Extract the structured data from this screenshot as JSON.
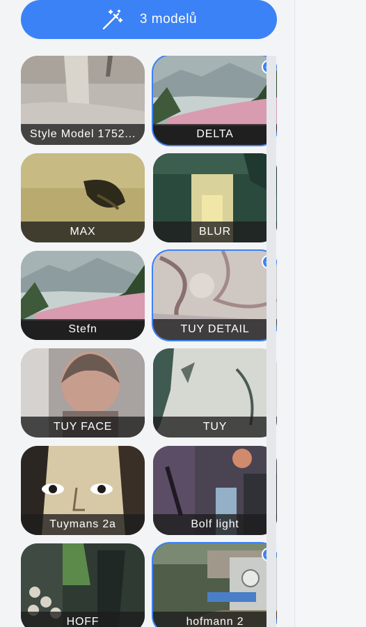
{
  "apply_button": {
    "label": "3 modelů",
    "icon": "magic-wand-icon"
  },
  "accent_color": "#3b82f6",
  "models": [
    {
      "name": "Style Model 1752...",
      "selected": false
    },
    {
      "name": "DELTA",
      "selected": true
    },
    {
      "name": "MAX",
      "selected": false
    },
    {
      "name": "BLUR",
      "selected": false
    },
    {
      "name": "Stefn",
      "selected": false
    },
    {
      "name": "TUY DETAIL",
      "selected": true
    },
    {
      "name": "TUY FACE",
      "selected": false
    },
    {
      "name": "TUY",
      "selected": false
    },
    {
      "name": "Tuymans 2a",
      "selected": false
    },
    {
      "name": "Bolf light",
      "selected": false
    },
    {
      "name": "HOFF",
      "selected": false
    },
    {
      "name": "hofmann 2",
      "selected": true
    }
  ]
}
